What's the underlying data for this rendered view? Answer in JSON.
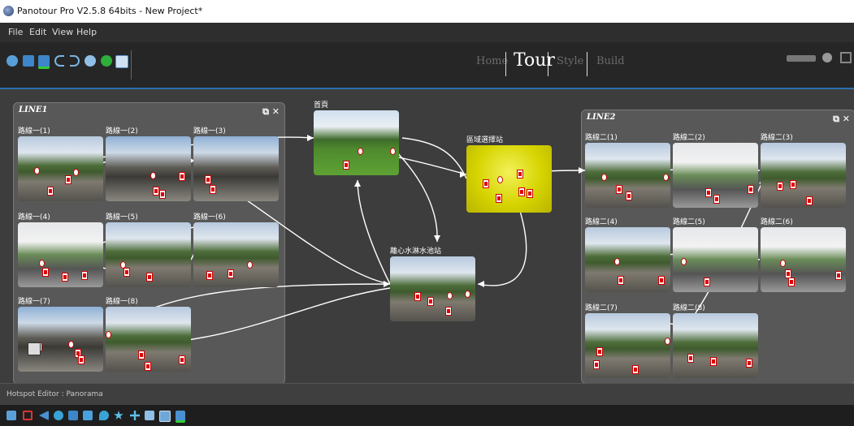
{
  "window": {
    "title": "Panotour Pro V2.5.8 64bits - New Project*"
  },
  "menu": [
    "File",
    "Edit",
    "View",
    "Help"
  ],
  "toolbar": {
    "icons": [
      "search-icon",
      "save-icon",
      "save-as-icon",
      "undo-icon",
      "redo-icon",
      "settings-icon",
      "play-icon",
      "screen-icon"
    ]
  },
  "modes": {
    "home": "Home",
    "tour": "Tour",
    "style": "Style",
    "build": "Build",
    "active": "Tour"
  },
  "groups": {
    "line1": {
      "title": "LINE1",
      "controls": "⧉ ✕"
    },
    "line2": {
      "title": "LINE2",
      "controls": "⧉ ✕"
    }
  },
  "nodes": {
    "l1_1": "路線一(1)",
    "l1_2": "路線一(2)",
    "l1_3": "路線一(3)",
    "l1_4": "路線一(4)",
    "l1_5": "路線一(5)",
    "l1_6": "路線一(6)",
    "l1_7": "路線一(7)",
    "l1_8": "路線一(8)",
    "home": "首頁",
    "hub_yellow": "區域選擇站",
    "hub_water": "離心水淋水池站",
    "l2_1": "路線二(1)",
    "l2_2": "路線二(2)",
    "l2_3": "路線二(3)",
    "l2_4": "路線二(4)",
    "l2_5": "路線二(5)",
    "l2_6": "路線二(6)",
    "l2_7": "路線二(7)",
    "l2_8": "路線二(8)"
  },
  "props": {
    "label": "Hotspot Editor : Panorama"
  },
  "bottom_toolbar": {
    "icons": [
      "select-icon",
      "hotspot-icon",
      "arrow-icon",
      "add-point-icon",
      "polygon-icon",
      "image-icon",
      "drop-icon",
      "star-icon",
      "plus-icon",
      "square-icon",
      "picture-icon",
      "export-icon"
    ]
  },
  "colors": {
    "accent": "#2a6fb0",
    "edge": "#ffffff",
    "hotspot": "#cc0000"
  }
}
